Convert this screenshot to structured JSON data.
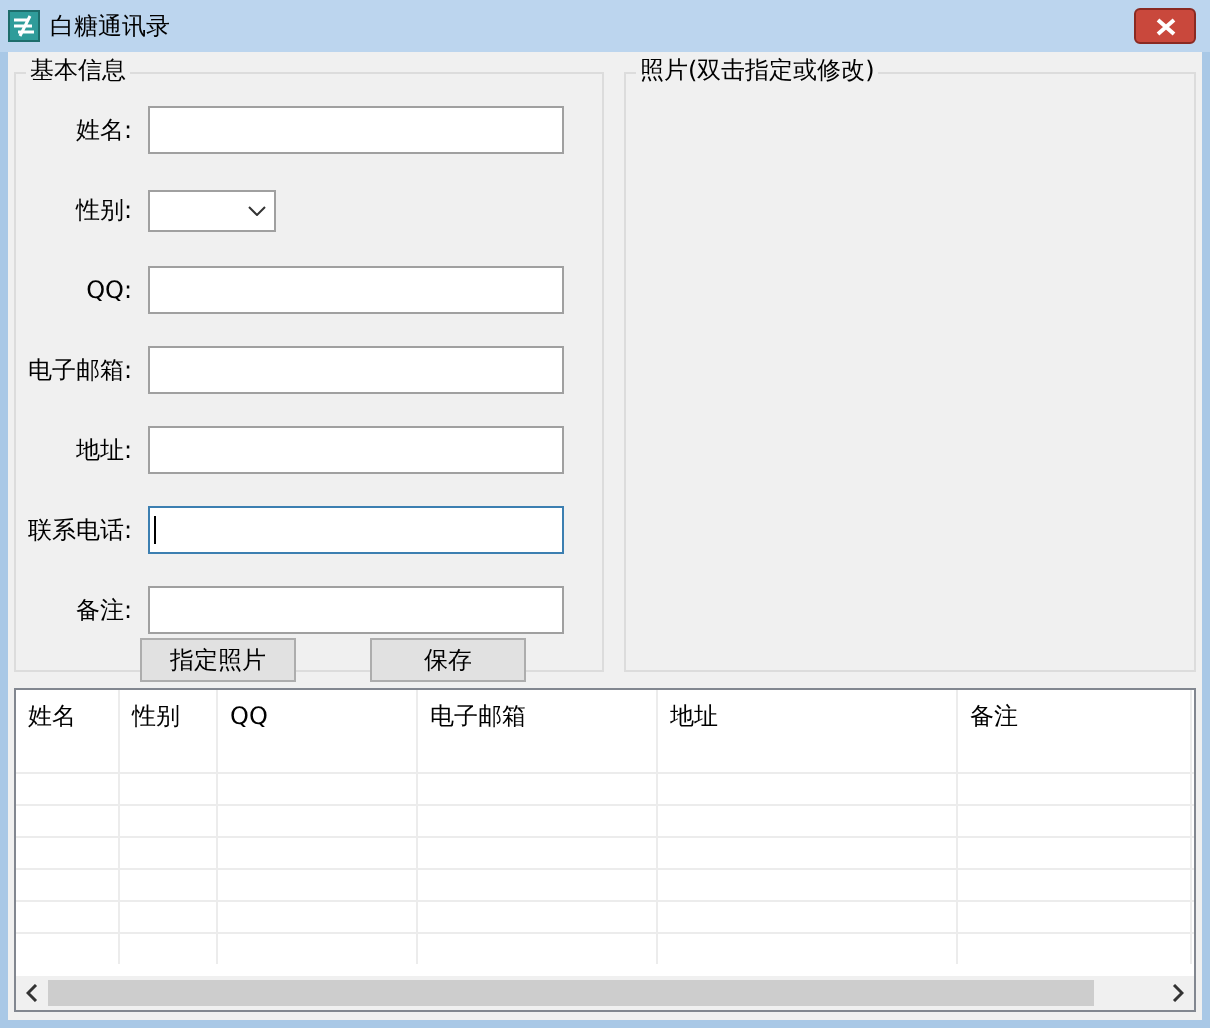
{
  "window": {
    "title": "白糖通讯录"
  },
  "basic_info": {
    "title": "基本信息",
    "fields": [
      {
        "label": "姓名:",
        "kind": "text",
        "focused": false
      },
      {
        "label": "性别:",
        "kind": "select",
        "focused": false
      },
      {
        "label": "QQ:",
        "kind": "text",
        "focused": false
      },
      {
        "label": "电子邮箱:",
        "kind": "text",
        "focused": false
      },
      {
        "label": "地址:",
        "kind": "text",
        "focused": false
      },
      {
        "label": "联系电话:",
        "kind": "text",
        "focused": true
      },
      {
        "label": "备注:",
        "kind": "text",
        "focused": false
      }
    ],
    "buttons": [
      "指定照片",
      "保存"
    ]
  },
  "photo": {
    "title": "照片(双击指定或修改)"
  },
  "table": {
    "columns": [
      "姓名",
      "性别",
      "QQ",
      "电子邮箱",
      "地址",
      "备注"
    ]
  }
}
